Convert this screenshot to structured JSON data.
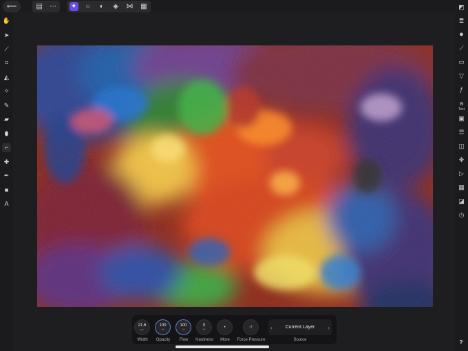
{
  "topbar": {
    "back_icon": "back-arrow-icon",
    "doc_icons": [
      "document-icon",
      "more-icon"
    ],
    "persona_icons": [
      "photo-persona-icon",
      "liquify-persona-icon",
      "develop-persona-icon",
      "tone-mapping-persona-icon",
      "export-persona-icon",
      "sidecar-icon"
    ],
    "active_persona": "photo-persona-icon"
  },
  "left_tools": [
    "hand-tool-icon",
    "move-tool-icon",
    "color-picker-icon",
    "crop-tool-icon",
    "flood-fill-icon",
    "selection-brush-icon",
    "paint-brush-icon",
    "eraser-icon",
    "dodge-burn-icon",
    "clone-brush-icon",
    "healing-brush-icon",
    "pen-tool-icon",
    "rectangle-tool-icon",
    "text-tool-icon"
  ],
  "active_tool": "clone-brush-icon",
  "right_tools": [
    "navigator-icon",
    "layers-icon",
    "color-icon",
    "brushes-icon",
    "histogram-icon",
    "adjustments-icon",
    "effects-icon",
    "text-studio-icon",
    "snapshots-icon",
    "styles-icon",
    "channels-icon",
    "transform-icon",
    "history-icon",
    "swatches-icon",
    "stock-icon",
    "info-icon"
  ],
  "right_small_labels": {
    "text_studio": "Text"
  },
  "context_toolbar": {
    "controls": [
      {
        "name": "width",
        "value": "21.6",
        "unit": "px",
        "label": "Width",
        "ring": false
      },
      {
        "name": "opacity",
        "value": "100",
        "unit": "%",
        "label": "Opacity",
        "ring": true
      },
      {
        "name": "flow",
        "value": "100",
        "unit": "%",
        "label": "Flow",
        "ring": true
      },
      {
        "name": "hardness",
        "value": "0",
        "unit": "%",
        "label": "Hardness",
        "ring": false
      }
    ],
    "more_label": "More",
    "force_pressure_label": "Force Pressure",
    "source_value": "Current Layer",
    "source_label": "Source"
  },
  "help": {
    "label": "?"
  },
  "colors": {
    "accent": "#6a4ae0",
    "panel": "#1b1b1d",
    "background": "#1e1e20",
    "ring": "#5a82c8"
  }
}
